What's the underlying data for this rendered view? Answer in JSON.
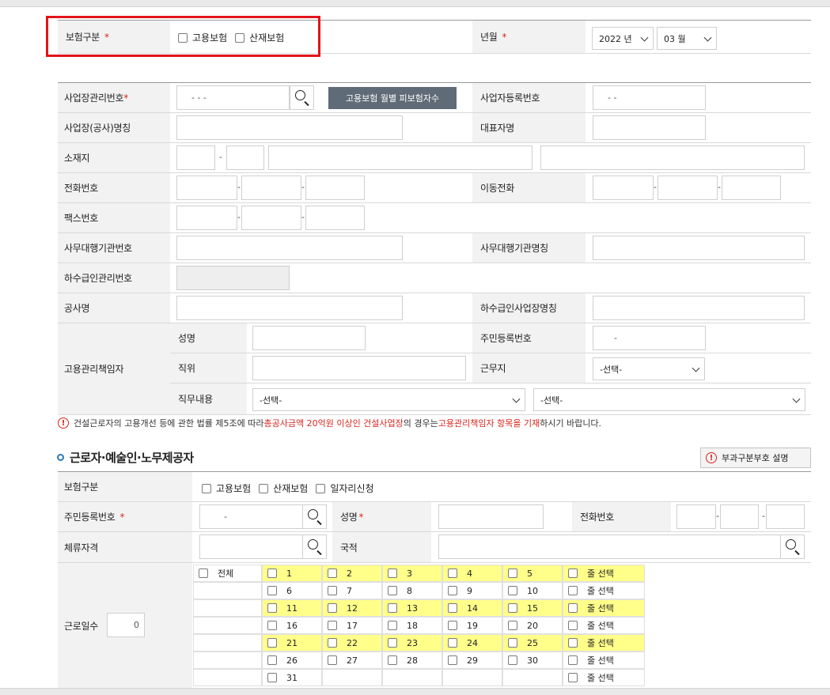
{
  "top": {
    "insurance_type_label": "보험구분",
    "required_mark": "*",
    "employment_insurance": "고용보험",
    "industrial_insurance": "산재보험",
    "year_month_label": "년월",
    "year_value": "2022 년",
    "month_value": "03 월"
  },
  "workplace": {
    "mgmt_no_label": "사업장관리번호",
    "mgmt_no_value": "- -   -",
    "monthly_button": "고용보험 월별 피보험자수",
    "biz_reg_label": "사업자등록번호",
    "biz_reg_value": "- -",
    "name_label": "사업장(공사)명칭",
    "rep_label": "대표자명",
    "address_label": "소재지",
    "address_sep": "-",
    "phone_label": "전화번호",
    "mobile_label": "이동전화",
    "fax_label": "팩스번호",
    "agency_no_label": "사무대행기관번호",
    "agency_name_label": "사무대행기관명칭",
    "sub_mgmt_label": "하수급인관리번호",
    "project_label": "공사명",
    "sub_name_label": "하수급인사업장명칭",
    "manager_label": "고용관리책임자",
    "mgr_name_label": "성명",
    "mgr_rrn_label": "주민등록번호",
    "mgr_rrn_value": "-",
    "mgr_position_label": "직위",
    "mgr_worksite_label": "근무지",
    "mgr_worksite_value": "-선택-",
    "mgr_duty_label": "직무내용",
    "duty_select1": "-선택-",
    "duty_select2": "-선택-"
  },
  "notice": {
    "icon": "!",
    "part1": "건설근로자의 고용개선 등에 관한 법률 제5조에 따라 ",
    "part2": "총공사금액 20억원 이상인 건설사업장",
    "part3": "의 경우는 ",
    "part4": "고용관리책임자 항목을 기재",
    "part5": "하시기 바랍니다."
  },
  "workers": {
    "section_title": "근로자·예술인·노무제공자",
    "levy_button": "부과구분부호 설명",
    "insurance_label": "보험구분",
    "employment": "고용보험",
    "industrial": "산재보험",
    "daily_job": "일자리신청",
    "rrn_label": "주민등록번호",
    "rrn_value": "-",
    "name_label": "성명",
    "phone_label": "전화번호",
    "stay_label": "체류자격",
    "nationality_label": "국적",
    "workdays_label": "근로일수",
    "workdays_value": "0",
    "all_label": "전체",
    "row_select_label": "줄 선택",
    "days": [
      [
        "1",
        "2",
        "3",
        "4",
        "5"
      ],
      [
        "6",
        "7",
        "8",
        "9",
        "10"
      ],
      [
        "11",
        "12",
        "13",
        "14",
        "15"
      ],
      [
        "16",
        "17",
        "18",
        "19",
        "20"
      ],
      [
        "21",
        "22",
        "23",
        "24",
        "25"
      ],
      [
        "26",
        "27",
        "28",
        "29",
        "30"
      ],
      [
        "31"
      ]
    ]
  },
  "colors": {
    "highlight_red": "#e3141a",
    "required_red": "#d9251d",
    "button_gray": "#5f6b77",
    "day_highlight": "#ffff8a",
    "label_bg": "#f2f2f2"
  }
}
